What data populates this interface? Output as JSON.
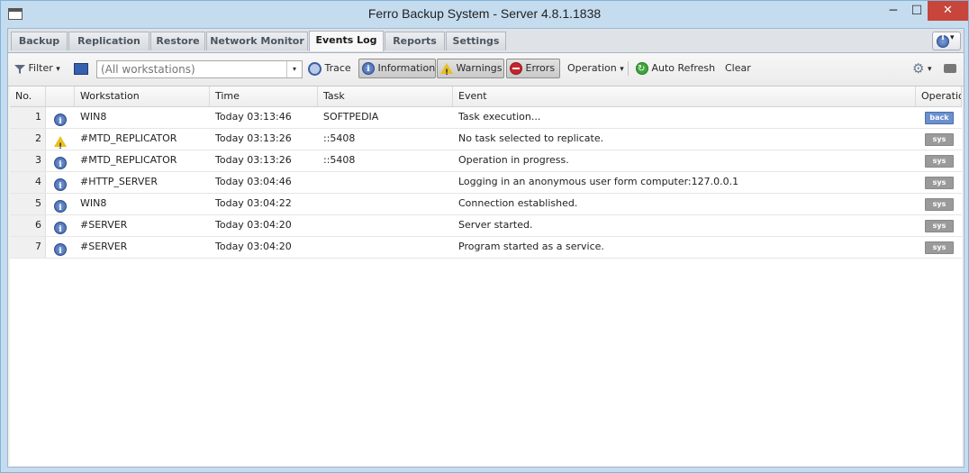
{
  "window": {
    "title": "Ferro Backup System - Server 4.8.1.1838"
  },
  "controls": {
    "minimize": "─",
    "maximize": "☐",
    "close": "✕"
  },
  "tabs": [
    {
      "label": "Backup",
      "active": false
    },
    {
      "label": "Replication",
      "active": false
    },
    {
      "label": "Restore",
      "active": false
    },
    {
      "label": "Network Monitor",
      "active": false
    },
    {
      "label": "Events Log",
      "active": true
    },
    {
      "label": "Reports",
      "active": false
    },
    {
      "label": "Settings",
      "active": false
    }
  ],
  "toolbar": {
    "filter_label": "Filter",
    "workstation_placeholder": "(All workstations)",
    "trace_label": "Trace",
    "information_label": "Information",
    "warnings_label": "Warnings",
    "errors_label": "Errors",
    "operation_label": "Operation",
    "auto_refresh_label": "Auto Refresh",
    "clear_label": "Clear",
    "dropdown_glyph": "▾"
  },
  "columns": [
    "No.",
    "",
    "Workstation",
    "Time",
    "Task",
    "Event",
    "Operation"
  ],
  "rows": [
    {
      "no": "1",
      "icon": "info-icon",
      "workstation": "WIN8",
      "time": "Today 03:13:46",
      "task": "SOFTPEDIA",
      "event": "Task execution...",
      "operation": "back",
      "op_style": "blue"
    },
    {
      "no": "2",
      "icon": "warning-icon",
      "workstation": "#MTD_REPLICATOR",
      "time": "Today 03:13:26",
      "task": "::5408",
      "event": "No task selected to replicate.",
      "operation": "sys",
      "op_style": "gray"
    },
    {
      "no": "3",
      "icon": "info-icon",
      "workstation": "#MTD_REPLICATOR",
      "time": "Today 03:13:26",
      "task": "::5408",
      "event": "Operation in progress.",
      "operation": "sys",
      "op_style": "gray"
    },
    {
      "no": "4",
      "icon": "info-icon",
      "workstation": "#HTTP_SERVER",
      "time": "Today 03:04:46",
      "task": "",
      "event": "Logging in an anonymous user form computer:127.0.0.1",
      "operation": "sys",
      "op_style": "gray"
    },
    {
      "no": "5",
      "icon": "info-icon",
      "workstation": "WIN8",
      "time": "Today 03:04:22",
      "task": "",
      "event": "Connection established.",
      "operation": "sys",
      "op_style": "gray"
    },
    {
      "no": "6",
      "icon": "info-icon",
      "workstation": "#SERVER",
      "time": "Today 03:04:20",
      "task": "",
      "event": "Server started.",
      "operation": "sys",
      "op_style": "gray"
    },
    {
      "no": "7",
      "icon": "info-icon",
      "workstation": "#SERVER",
      "time": "Today 03:04:20",
      "task": "",
      "event": "Program started as a service.",
      "operation": "sys",
      "op_style": "gray"
    }
  ],
  "colors": {
    "accent": "#c5dcef",
    "close": "#c7453a",
    "info": "#3a5ea5",
    "warning": "#e9c020",
    "error": "#c8242c"
  }
}
